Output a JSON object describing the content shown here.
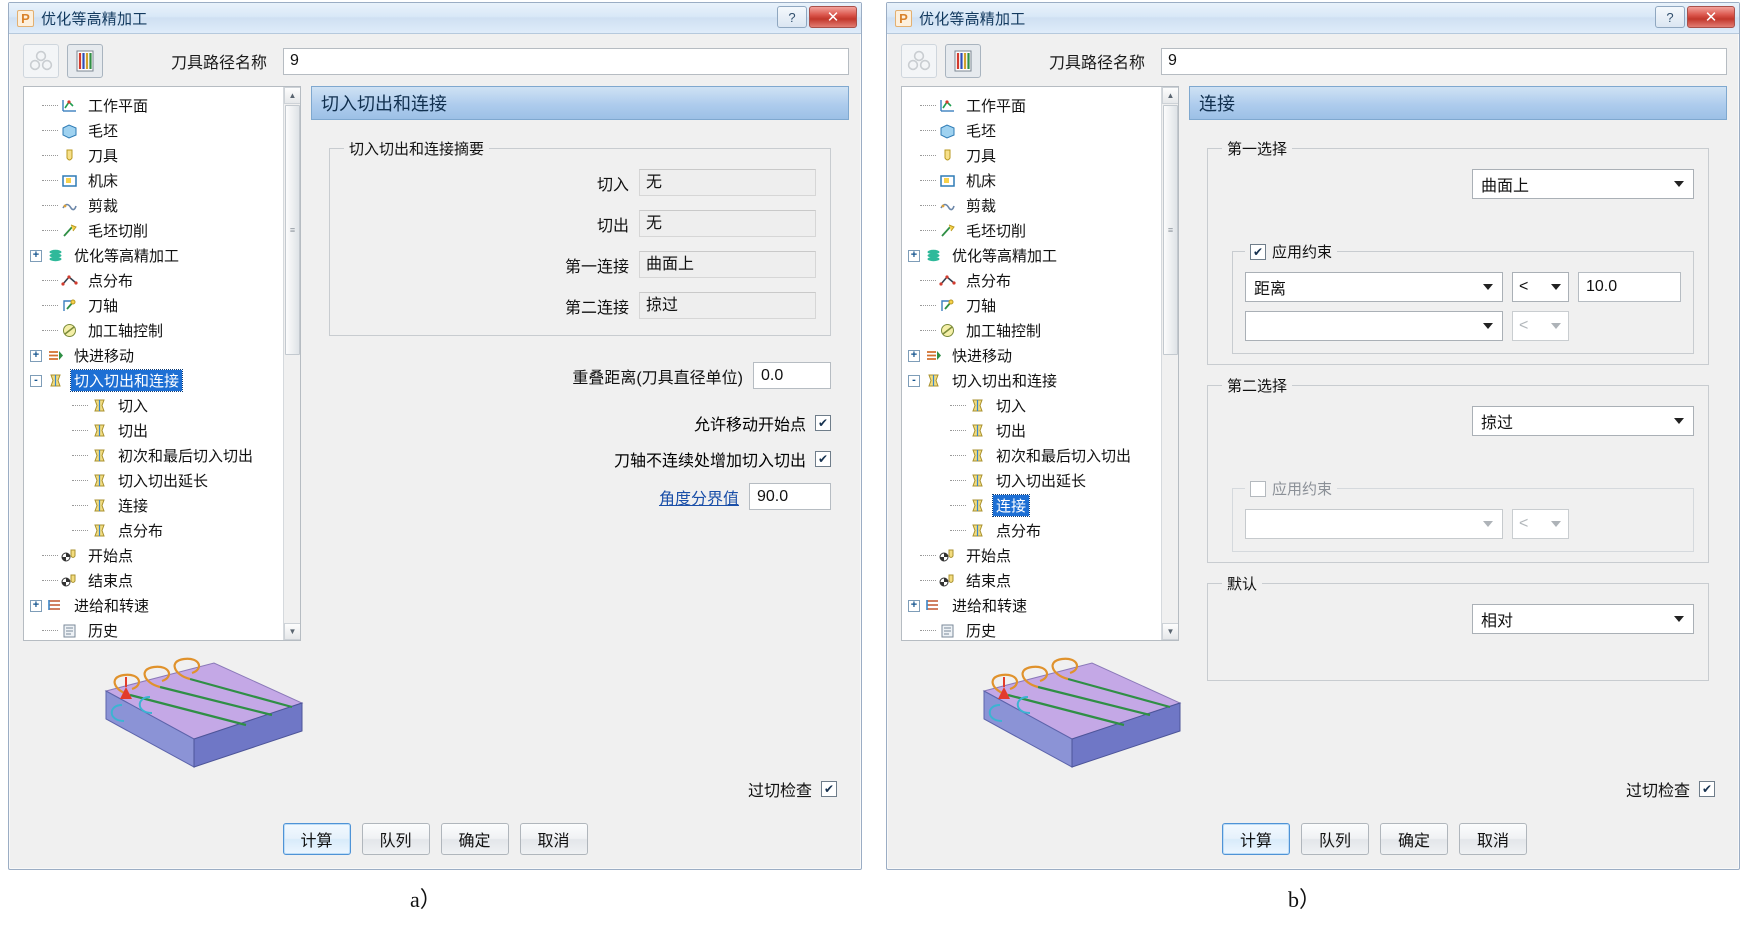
{
  "dialog_a": {
    "title": "优化等高精加工",
    "title_icon": "P",
    "window_buttons": {
      "help": "?",
      "close": "✕"
    },
    "toolbar": {
      "icon_left": "recycle-icon",
      "icon_right": "toolpath-preview-icon"
    },
    "toolpath": {
      "label": "刀具路径名称",
      "value": "9"
    },
    "tree": [
      {
        "label": "工作平面",
        "indent": 1,
        "expander": "",
        "icon": "workplane-icon",
        "selected": false
      },
      {
        "label": "毛坯",
        "indent": 1,
        "expander": "",
        "icon": "block-icon",
        "selected": false
      },
      {
        "label": "刀具",
        "indent": 1,
        "expander": "",
        "icon": "tool-icon",
        "selected": false
      },
      {
        "label": "机床",
        "indent": 1,
        "expander": "",
        "icon": "machine-icon",
        "selected": false
      },
      {
        "label": "剪裁",
        "indent": 1,
        "expander": "",
        "icon": "clip-icon",
        "selected": false
      },
      {
        "label": "毛坯切削",
        "indent": 1,
        "expander": "",
        "icon": "blockcut-icon",
        "selected": false
      },
      {
        "label": "优化等高精加工",
        "indent": 0,
        "expander": "+",
        "icon": "strategy-icon",
        "selected": false
      },
      {
        "label": "点分布",
        "indent": 1,
        "expander": "",
        "icon": "pointdist-icon",
        "selected": false
      },
      {
        "label": "刀轴",
        "indent": 1,
        "expander": "",
        "icon": "toolaxis-icon",
        "selected": false
      },
      {
        "label": "加工轴控制",
        "indent": 1,
        "expander": "",
        "icon": "axisctrl-icon",
        "selected": false
      },
      {
        "label": "快进移动",
        "indent": 0,
        "expander": "+",
        "icon": "rapidmove-icon",
        "selected": false
      },
      {
        "label": "切入切出和连接",
        "indent": 0,
        "expander": "-",
        "icon": "leads-icon",
        "selected": true
      },
      {
        "label": "切入",
        "indent": 2,
        "expander": "",
        "icon": "leadin-icon",
        "selected": false
      },
      {
        "label": "切出",
        "indent": 2,
        "expander": "",
        "icon": "leadout-icon",
        "selected": false
      },
      {
        "label": "初次和最后切入切出",
        "indent": 2,
        "expander": "",
        "icon": "firstlast-icon",
        "selected": false
      },
      {
        "label": "切入切出延长",
        "indent": 2,
        "expander": "",
        "icon": "extension-icon",
        "selected": false
      },
      {
        "label": "连接",
        "indent": 2,
        "expander": "",
        "icon": "links-icon",
        "selected": false
      },
      {
        "label": "点分布",
        "indent": 2,
        "expander": "",
        "icon": "pointdist2-icon",
        "selected": false
      },
      {
        "label": "开始点",
        "indent": 1,
        "expander": "",
        "icon": "startpoint-icon",
        "selected": false
      },
      {
        "label": "结束点",
        "indent": 1,
        "expander": "",
        "icon": "endpoint-icon",
        "selected": false
      },
      {
        "label": "进给和转速",
        "indent": 0,
        "expander": "+",
        "icon": "feedspeed-icon",
        "selected": false
      },
      {
        "label": "历史",
        "indent": 1,
        "expander": "",
        "icon": "history-icon",
        "selected": false
      }
    ],
    "pane_title": "切入切出和连接",
    "summary_group": "切入切出和连接摘要",
    "summary_rows": [
      {
        "label": "切入",
        "value": "无"
      },
      {
        "label": "切出",
        "value": "无"
      },
      {
        "label": "第一连接",
        "value": "曲面上"
      },
      {
        "label": "第二连接",
        "value": "掠过"
      }
    ],
    "overlap": {
      "label": "重叠距离(刀具直径单位)",
      "value": "0.0"
    },
    "checkboxes": [
      {
        "label": "允许移动开始点",
        "checked": true
      },
      {
        "label": "刀轴不连续处增加切入切出",
        "checked": true
      }
    ],
    "angle": {
      "label": "角度分界值",
      "value": "90.0",
      "is_link": true
    },
    "gouge_check": {
      "label": "过切检查",
      "checked": true
    },
    "buttons": [
      {
        "label": "计算",
        "default": true
      },
      {
        "label": "队列",
        "default": false
      },
      {
        "label": "确定",
        "default": false
      },
      {
        "label": "取消",
        "default": false
      }
    ],
    "caption": "a）"
  },
  "dialog_b": {
    "title": "优化等高精加工",
    "title_icon": "P",
    "window_buttons": {
      "help": "?",
      "close": "✕"
    },
    "toolpath": {
      "label": "刀具路径名称",
      "value": "9"
    },
    "tree": [
      {
        "label": "工作平面",
        "indent": 1,
        "expander": "",
        "icon": "workplane-icon",
        "selected": false
      },
      {
        "label": "毛坯",
        "indent": 1,
        "expander": "",
        "icon": "block-icon",
        "selected": false
      },
      {
        "label": "刀具",
        "indent": 1,
        "expander": "",
        "icon": "tool-icon",
        "selected": false
      },
      {
        "label": "机床",
        "indent": 1,
        "expander": "",
        "icon": "machine-icon",
        "selected": false
      },
      {
        "label": "剪裁",
        "indent": 1,
        "expander": "",
        "icon": "clip-icon",
        "selected": false
      },
      {
        "label": "毛坯切削",
        "indent": 1,
        "expander": "",
        "icon": "blockcut-icon",
        "selected": false
      },
      {
        "label": "优化等高精加工",
        "indent": 0,
        "expander": "+",
        "icon": "strategy-icon",
        "selected": false
      },
      {
        "label": "点分布",
        "indent": 1,
        "expander": "",
        "icon": "pointdist-icon",
        "selected": false
      },
      {
        "label": "刀轴",
        "indent": 1,
        "expander": "",
        "icon": "toolaxis-icon",
        "selected": false
      },
      {
        "label": "加工轴控制",
        "indent": 1,
        "expander": "",
        "icon": "axisctrl-icon",
        "selected": false
      },
      {
        "label": "快进移动",
        "indent": 0,
        "expander": "+",
        "icon": "rapidmove-icon",
        "selected": false
      },
      {
        "label": "切入切出和连接",
        "indent": 0,
        "expander": "-",
        "icon": "leads-icon",
        "selected": false
      },
      {
        "label": "切入",
        "indent": 2,
        "expander": "",
        "icon": "leadin-icon",
        "selected": false
      },
      {
        "label": "切出",
        "indent": 2,
        "expander": "",
        "icon": "leadout-icon",
        "selected": false
      },
      {
        "label": "初次和最后切入切出",
        "indent": 2,
        "expander": "",
        "icon": "firstlast-icon",
        "selected": false
      },
      {
        "label": "切入切出延长",
        "indent": 2,
        "expander": "",
        "icon": "extension-icon",
        "selected": false
      },
      {
        "label": "连接",
        "indent": 2,
        "expander": "",
        "icon": "links-icon",
        "selected": true
      },
      {
        "label": "点分布",
        "indent": 2,
        "expander": "",
        "icon": "pointdist2-icon",
        "selected": false
      },
      {
        "label": "开始点",
        "indent": 1,
        "expander": "",
        "icon": "startpoint-icon",
        "selected": false
      },
      {
        "label": "结束点",
        "indent": 1,
        "expander": "",
        "icon": "endpoint-icon",
        "selected": false
      },
      {
        "label": "进给和转速",
        "indent": 0,
        "expander": "+",
        "icon": "feedspeed-icon",
        "selected": false
      },
      {
        "label": "历史",
        "indent": 1,
        "expander": "",
        "icon": "history-icon",
        "selected": false
      }
    ],
    "pane_title": "连接",
    "first_choice": {
      "group_label": "第一选择",
      "type_value": "曲面上",
      "constraint": {
        "label": "应用约束",
        "checked": true,
        "row1": {
          "field": "距离",
          "operator": "<",
          "value": "10.0"
        },
        "row2": {
          "field": "",
          "operator": "<",
          "value": ""
        }
      }
    },
    "second_choice": {
      "group_label": "第二选择",
      "type_value": "掠过",
      "constraint": {
        "label": "应用约束",
        "checked": false,
        "row1": {
          "field": "",
          "operator": "<",
          "value": ""
        }
      }
    },
    "default_group": {
      "group_label": "默认",
      "value": "相对"
    },
    "gouge_check": {
      "label": "过切检查",
      "checked": true
    },
    "buttons": [
      {
        "label": "计算",
        "default": true
      },
      {
        "label": "队列",
        "default": false
      },
      {
        "label": "确定",
        "default": false
      },
      {
        "label": "取消",
        "default": false
      }
    ],
    "caption": "b）"
  },
  "colors": {
    "selection_blue": "#1d6fd4",
    "pane_header_blue": "#aecced",
    "title_bar_blue": "#d9e8f7",
    "close_red": "#c2372c",
    "link_blue": "#1a4fa8",
    "preview_block_top": "#c4a8e6",
    "preview_block_side": "#6f77c6"
  }
}
